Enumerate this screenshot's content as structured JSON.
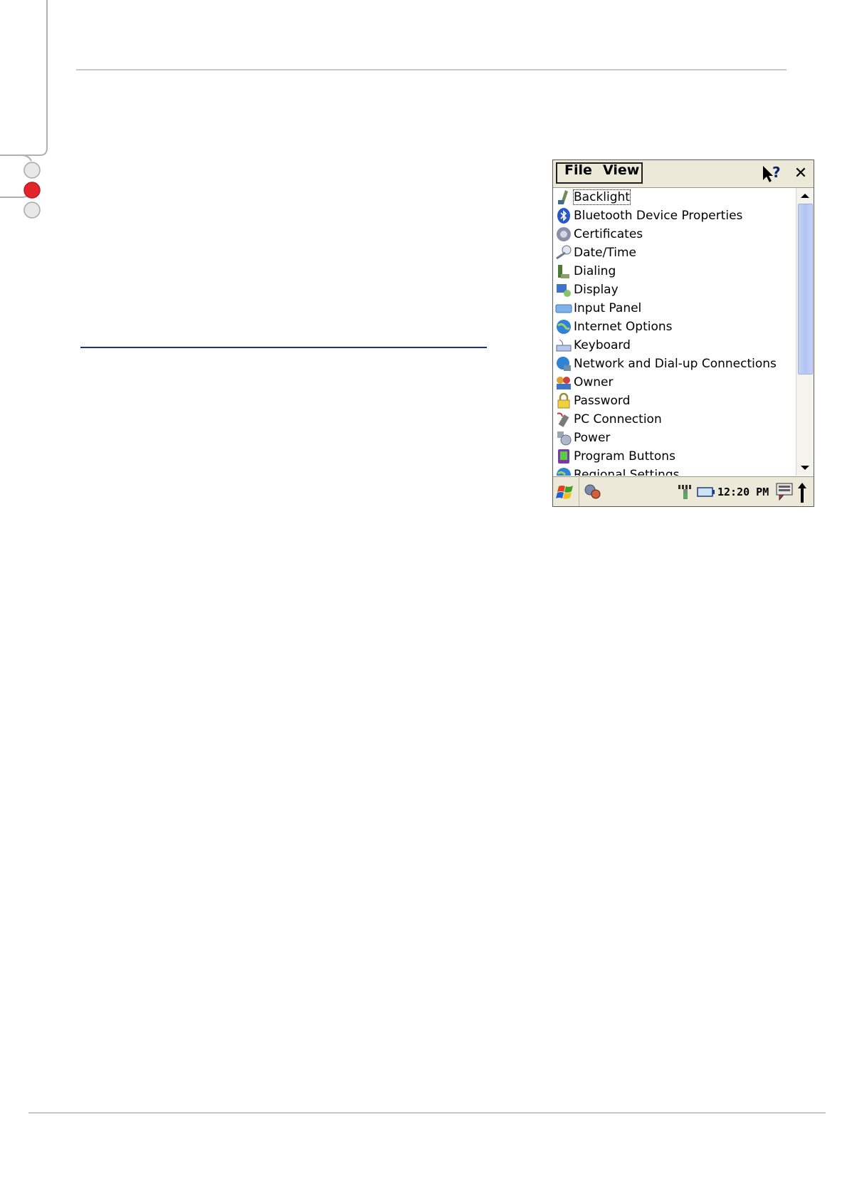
{
  "page": {
    "bullets": [
      "inactive",
      "active",
      "inactive"
    ]
  },
  "device": {
    "menu": {
      "file": "File",
      "view": "View"
    },
    "list_items": [
      {
        "label": "Backlight",
        "icon": "backlight-icon",
        "selected": true
      },
      {
        "label": "Bluetooth Device Properties",
        "icon": "bluetooth-icon"
      },
      {
        "label": "Certificates",
        "icon": "certificates-icon"
      },
      {
        "label": "Date/Time",
        "icon": "date-time-icon"
      },
      {
        "label": "Dialing",
        "icon": "dialing-icon"
      },
      {
        "label": "Display",
        "icon": "display-icon"
      },
      {
        "label": "Input Panel",
        "icon": "input-panel-icon"
      },
      {
        "label": "Internet Options",
        "icon": "internet-options-icon"
      },
      {
        "label": "Keyboard",
        "icon": "keyboard-icon"
      },
      {
        "label": "Network and Dial-up Connections",
        "icon": "network-icon"
      },
      {
        "label": "Owner",
        "icon": "owner-icon"
      },
      {
        "label": "Password",
        "icon": "password-icon"
      },
      {
        "label": "PC Connection",
        "icon": "pc-connection-icon"
      },
      {
        "label": "Power",
        "icon": "power-icon"
      },
      {
        "label": "Program Buttons",
        "icon": "program-buttons-icon"
      },
      {
        "label": "Regional Settings",
        "icon": "regional-settings-icon"
      }
    ],
    "taskbar": {
      "clock": "12:20 PM"
    },
    "colors": {
      "accent_red": "#d62a2a",
      "rule_blue": "#1f2f8f",
      "scroll_thumb": "#b0c3f2"
    }
  }
}
